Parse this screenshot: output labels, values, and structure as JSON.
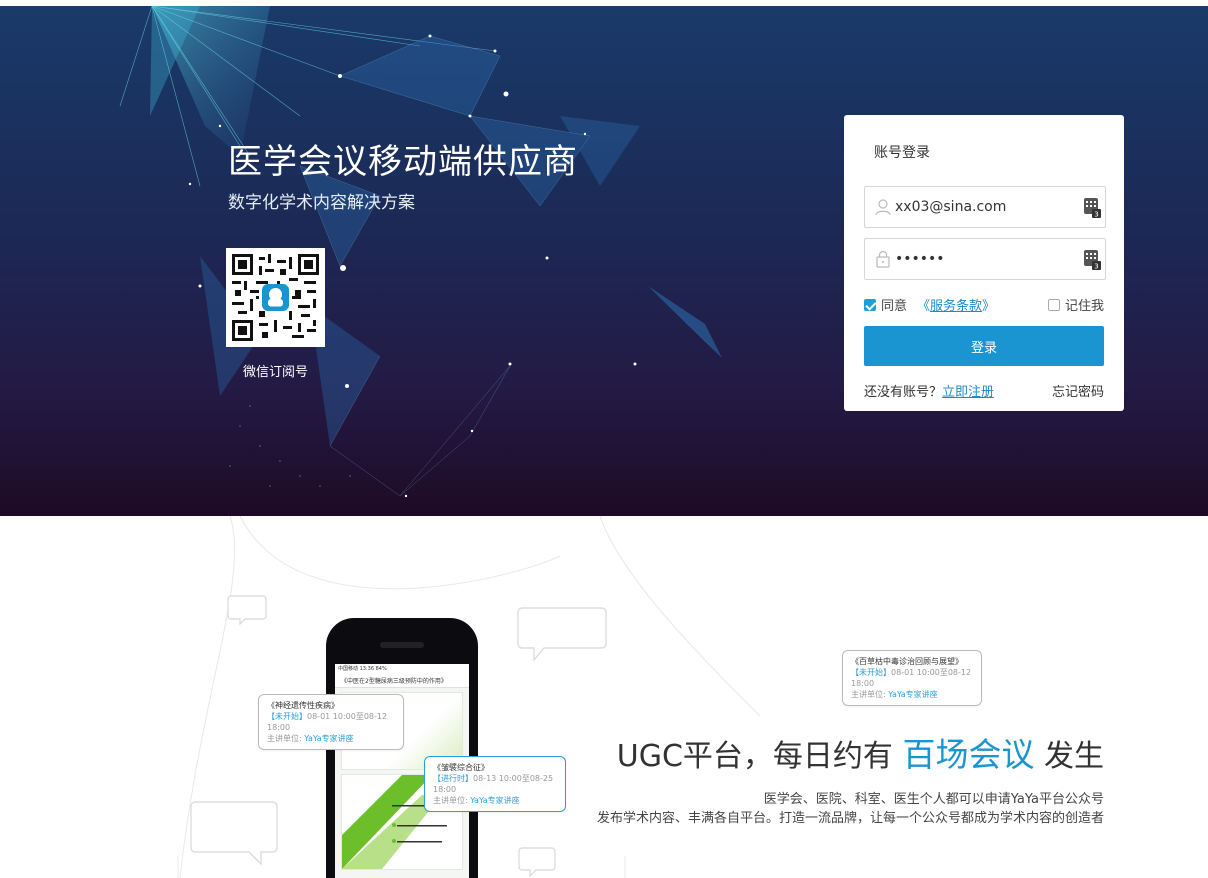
{
  "hero": {
    "title": "医学会议移动端供应商",
    "subtitle": "数字化学术内容解决方案",
    "qr_label": "微信订阅号"
  },
  "login": {
    "title": "账号登录",
    "username_value": "xx03@sina.com",
    "password_mask": "••••••",
    "agree_label": "同意",
    "terms_open": "《",
    "terms_link": "服务条款",
    "terms_close": "》",
    "agree_checked": true,
    "remember_label": "记住我",
    "remember_checked": false,
    "submit_label": "登录",
    "no_account_text": "还没有账号？",
    "register_link": "立即注册",
    "forgot_link": "忘记密码"
  },
  "feature": {
    "headline_before": "UGC平台，每日约有 ",
    "headline_highlight": "百场会议",
    "headline_after": " 发生",
    "desc_line1": "医学会、医院、科室、医生个人都可以申请YaYa平台公众号",
    "desc_line2": "发布学术内容、丰满各自平台。打造一流品牌，让每一个公众号都成为学术内容的创造者"
  },
  "bubbles": [
    {
      "title": "《神经遗传性疾病》",
      "status": "【未开始】",
      "time": "08-01 10:00至08-12 18:00",
      "org_label": "主讲单位:",
      "org": "YaYa专家讲座"
    },
    {
      "title": "《皱襞综合征》",
      "status": "【进行时】",
      "time": "08-13 10:00至08-25 18:00",
      "org_label": "主讲单位:",
      "org": "YaYa专家讲座"
    },
    {
      "title": "《百草枯中毒诊治回顾与展望》",
      "status": "【未开始】",
      "time": "08-01 10:00至08-12 18:00",
      "org_label": "主讲单位:",
      "org": "YaYa专家讲座"
    }
  ],
  "phone": {
    "status_bar": "中国移动  13:36  84%",
    "nav_title": "《中医在2型糖尿病三级预防中的作用》"
  },
  "colors": {
    "accent": "#1b95d1",
    "hero_top": "#1a3a6a",
    "hero_bottom": "#1e0a24"
  }
}
